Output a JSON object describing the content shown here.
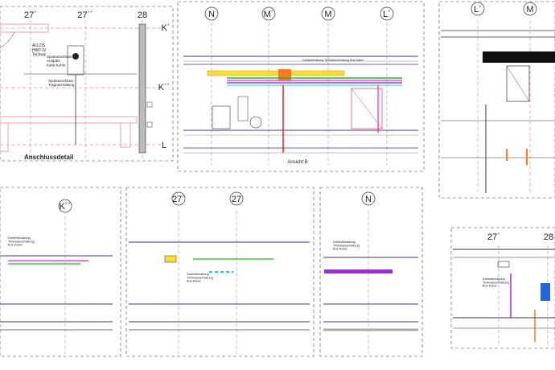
{
  "drawing": {
    "top_left": {
      "grid_labels": [
        "27´",
        "27´´",
        "28"
      ],
      "side_labels": [
        "K´",
        "K´´",
        "L"
      ],
      "room_label": "ALLOS\nHWT-IV\nTechnik",
      "note_1": "Spuleanschluss\nAufgabe\nKalte-Kuhle",
      "note_2": "Spuleanschluss\nTragnetzhaltung",
      "title": "Anschlussdetail"
    },
    "top_middle": {
      "grid_labels": [
        "N",
        "M´",
        "M",
        "L´"
      ],
      "caption": "Ansicht B",
      "note": "Dreileiterhaltung Trinkwasserhaltung Bus-Kabel"
    },
    "top_right": {
      "grid_labels": [
        "L´",
        "M"
      ]
    },
    "bottom_left": {
      "grid_labels": [
        "K´´"
      ],
      "note": "Dreileiterhaltung\nTrinkwasserhaltung\nBus-Kabel"
    },
    "bottom_middle": {
      "grid_labels": [
        "27´",
        "27"
      ],
      "note": "Dreileiterhaltung\nTrinkwasserhaltung\nBus-Kabel"
    },
    "bottom_center_right": {
      "grid_labels": [
        "N"
      ],
      "note": "Dreileiterhaltung\nTrinkwasserhaltung\nBus-Kabel"
    },
    "bottom_right": {
      "grid_labels": [
        "27´",
        "28"
      ],
      "note": "Dreileiterhaltung\nTrinkwasserhaltung\nBus-Kabel"
    }
  },
  "colors": {
    "pipe_blue": "#3333aa",
    "pipe_purple": "#6633cc",
    "yellow": "#ffdd33",
    "orange": "#ff7722",
    "magenta": "#ee22ee",
    "green": "#22bb22",
    "red": "#dd2222",
    "cyan": "#22cccc",
    "wall_red": "#e7a3a3",
    "dark": "#222222"
  }
}
